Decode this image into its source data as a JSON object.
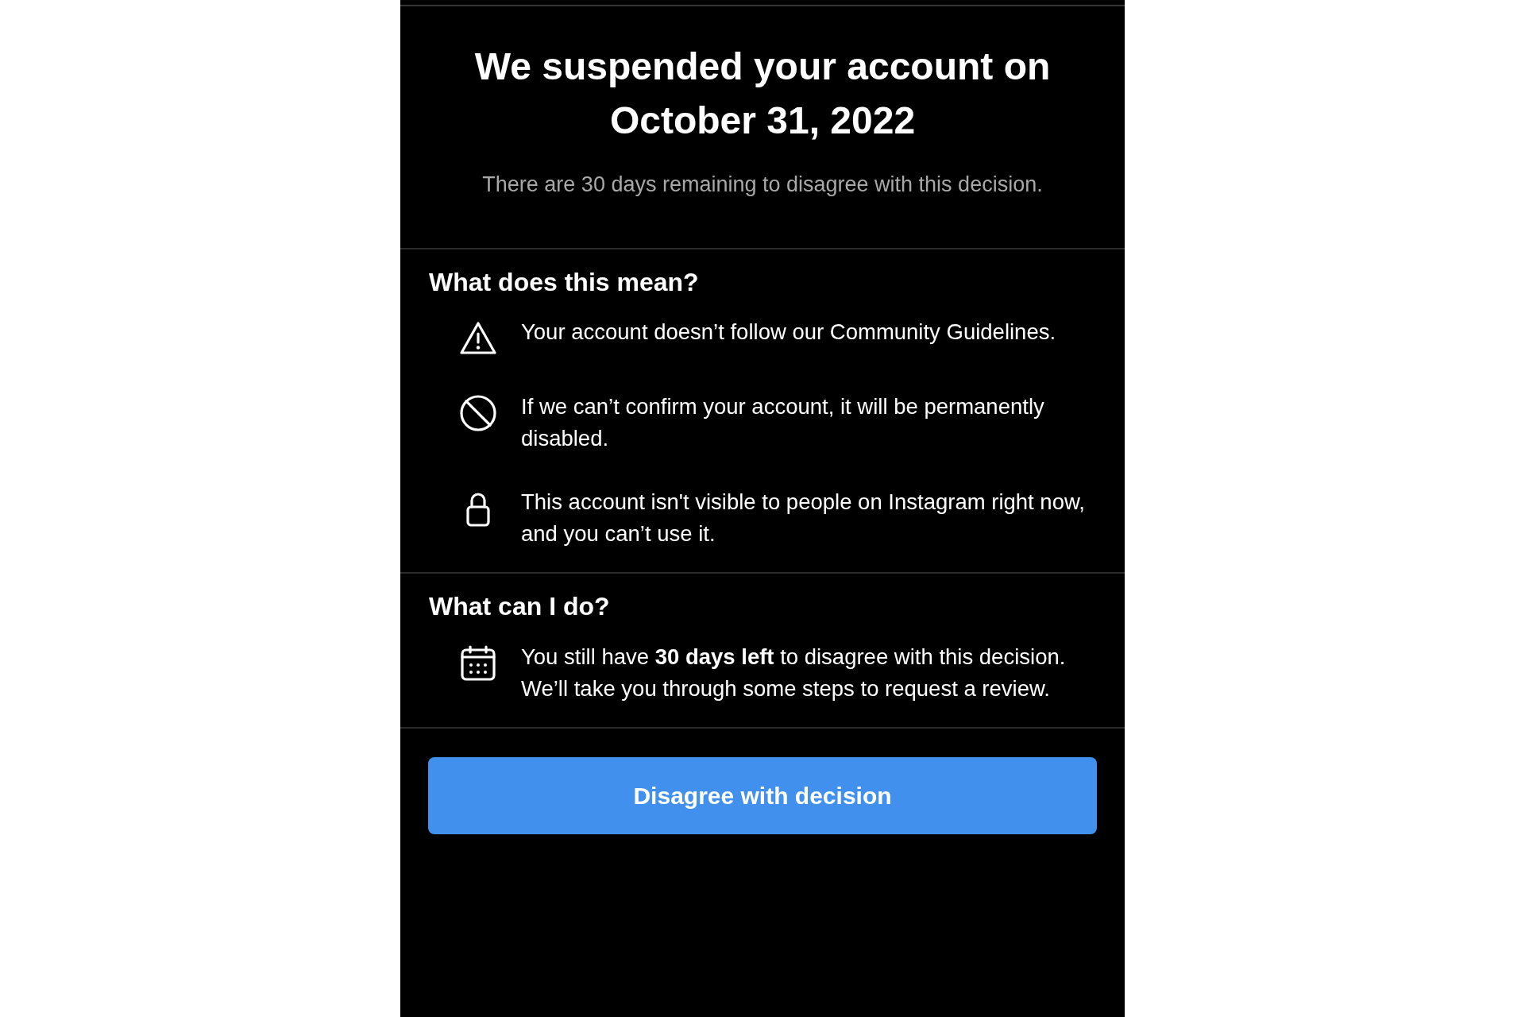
{
  "header": {
    "title": "We suspended your account on October 31, 2022",
    "subtitle": "There are 30 days remaining to disagree with this decision."
  },
  "sections": [
    {
      "heading": "What does this mean?",
      "items": [
        {
          "text": "Your account doesn’t follow our Community Guidelines."
        },
        {
          "text": "If we can’t confirm your account, it will be permanently disabled."
        },
        {
          "text": "This account isn't visible to people on Instagram right now, and you can’t use it."
        }
      ]
    },
    {
      "heading": "What can I do?",
      "items": [
        {
          "text": "You still have **30 days left** to disagree with this decision. We’ll take you through some steps to request a review."
        }
      ]
    }
  ],
  "button": {
    "label": "Disagree with decision"
  }
}
